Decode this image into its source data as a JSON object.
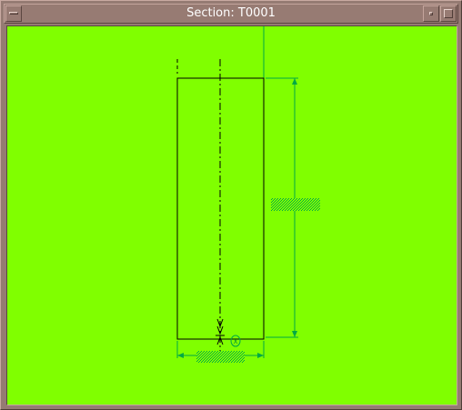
{
  "window": {
    "title": "Section: T0001"
  },
  "drawing": {
    "background": "#80ff00",
    "outline_color": "#000000",
    "dimension_color": "#00aa44",
    "length_value": "",
    "width_value": "",
    "tip_label": "X"
  },
  "icons": {
    "menu": "window-menu-icon",
    "minimize": "minimize-icon",
    "maximize": "maximize-icon"
  }
}
